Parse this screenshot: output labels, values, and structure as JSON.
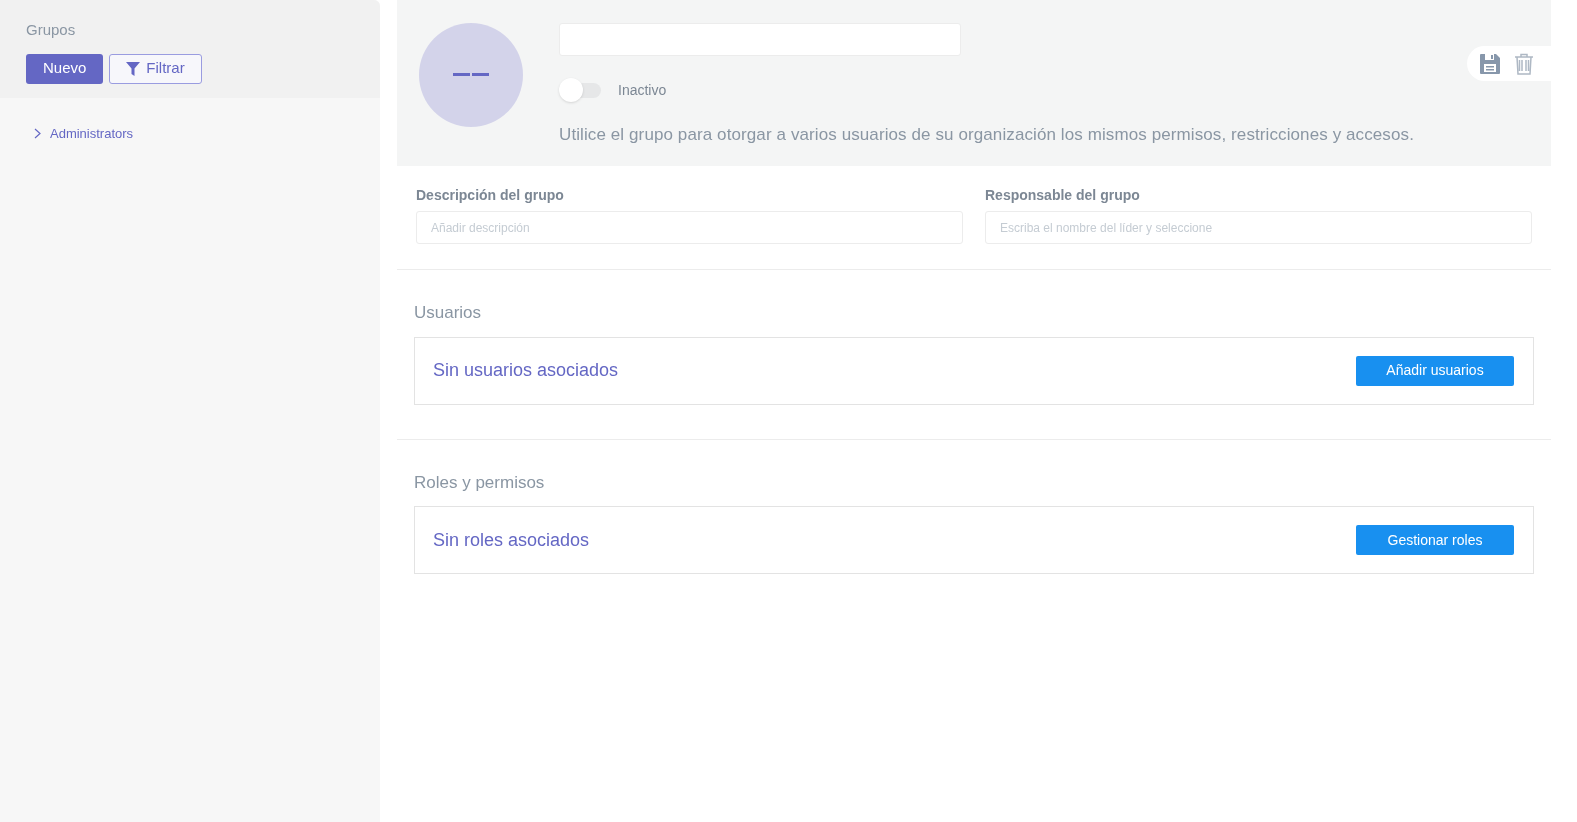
{
  "sidebar": {
    "title": "Grupos",
    "new_button": "Nuevo",
    "filter_button": "Filtrar",
    "tree": [
      {
        "label": "Administrators",
        "expanded": false
      }
    ]
  },
  "header": {
    "status_toggle": {
      "on": false,
      "label": "Inactivo"
    },
    "description": "Utilice el grupo para otorgar a varios usuarios de su organización los mismos permisos, restricciones y accesos."
  },
  "fields": [
    {
      "label": "Descripción del grupo",
      "placeholder": "Añadir descripción"
    },
    {
      "label": "Responsable del grupo",
      "placeholder": "Escriba el nombre del líder y seleccione"
    }
  ],
  "sections": [
    {
      "title": "Usuarios",
      "empty_text": "Sin usuarios asociados",
      "button": "Añadir usuarios"
    },
    {
      "title": "Roles y permisos",
      "empty_text": "Sin roles asociados",
      "button": "Gestionar roles"
    }
  ]
}
